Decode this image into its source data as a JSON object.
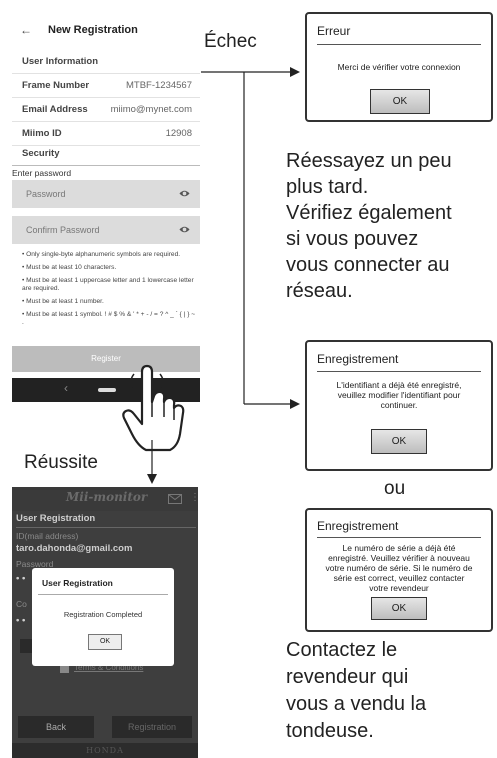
{
  "phone_registration": {
    "back_arrow": "←",
    "title": "New Registration",
    "rows": [
      {
        "label": "User Information",
        "value": ""
      },
      {
        "label": "Frame Number",
        "value": "MTBF-1234567"
      },
      {
        "label": "Email Address",
        "value": "miimo@mynet.com"
      },
      {
        "label": "Miimo ID",
        "value": "12908"
      },
      {
        "label": "Security",
        "value": ""
      }
    ],
    "enter_password_label": "Enter password",
    "password_placeholder": "Password",
    "confirm_password_placeholder": "Confirm Password",
    "rules": [
      "• Only single-byte alphanumeric symbols are required.",
      "• Must be at least 10 characters.",
      "• Must be at least 1 uppercase letter and 1 lowercase letter are required.",
      "• Must be at least 1 number.",
      "• Must be at least 1 symbol. ! # $ % & ' * + - / = ? ^ _ ` { | } ~ ."
    ],
    "register_label": "Register",
    "nav_back_glyph": "‹"
  },
  "phone_monitor": {
    "app_logo": "Mii-monitor",
    "section_title": "User Registration",
    "id_label": "ID(mail address)",
    "id_value": "taro.dahonda@gmail.com",
    "password_label": "Password",
    "password_dots": "• •",
    "confirm_label_partial": "Co",
    "confirm_dots": "• •",
    "terms_label": "Terms & Conditions",
    "back_button": "Back",
    "registration_button": "Registration",
    "footer_brand": "HONDA",
    "dialog": {
      "title": "User Registration",
      "message": "Registration Completed",
      "ok": "OK"
    }
  },
  "flow": {
    "fail_label": "Échec",
    "success_label": "Réussite",
    "or_label": "ou"
  },
  "error_dialog": {
    "title": "Erreur",
    "message": "Merci de vérifier votre connexion",
    "ok": "OK"
  },
  "retry_text": [
    "Réessayez un peu",
    "plus tard.",
    "Vérifiez également",
    "si vous pouvez",
    "vous connecter au",
    "réseau."
  ],
  "id_dialog": {
    "title": "Enregistrement",
    "message": [
      "L'identifiant a déjà été enregistré,",
      "veuillez modifier l'identifiant pour",
      "continuer."
    ],
    "ok": "OK"
  },
  "serial_dialog": {
    "title": "Enregistrement",
    "message": [
      "Le numéro de série a déjà été",
      "enregistré. Veuillez vérifier à nouveau",
      "votre numéro de série. Si le numéro de",
      "série est correct, veuillez contacter",
      "votre revendeur"
    ],
    "ok": "OK"
  },
  "contact_text": [
    "Contactez le",
    "revendeur qui",
    "vous a vendu la",
    "tondeuse."
  ]
}
